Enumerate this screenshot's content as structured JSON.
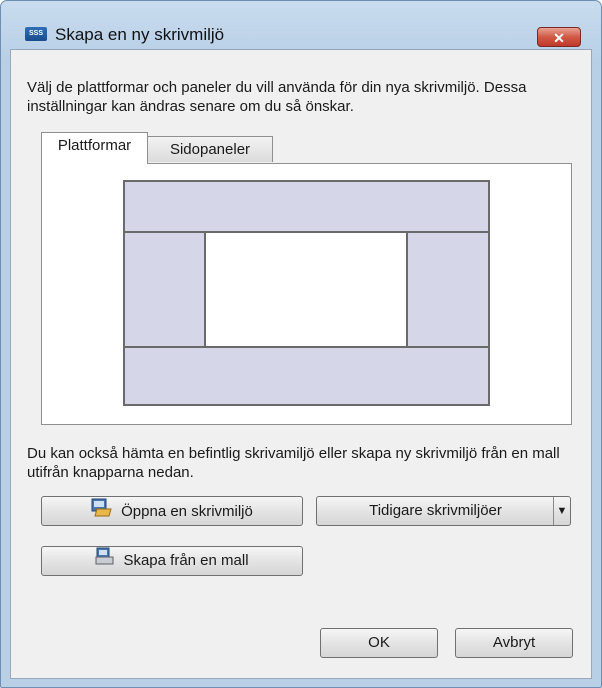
{
  "window": {
    "title": "Skapa en ny skrivmiljö",
    "close_label": "✕",
    "app_icon_text": "SSS"
  },
  "description": "Välj de plattformar och paneler du vill använda för din nya skrivmiljö. Dessa inställningar kan ändras senare om du så önskar.",
  "tabs": [
    {
      "label": "Plattformar",
      "active": true
    },
    {
      "label": "Sidopaneler",
      "active": false
    }
  ],
  "info": "Du kan också hämta en befintlig skrivamiljö eller skapa ny skrivmiljö från en mall utifrån knapparna nedan.",
  "buttons": {
    "open": "Öppna en skrivmiljö",
    "previous": "Tidigare skrivmiljöer",
    "from_template": "Skapa från en mall",
    "ok": "OK",
    "cancel": "Avbryt"
  },
  "icons": {
    "open": "folder-open-icon",
    "template": "template-icon",
    "dropdown": "chevron-down-icon"
  }
}
